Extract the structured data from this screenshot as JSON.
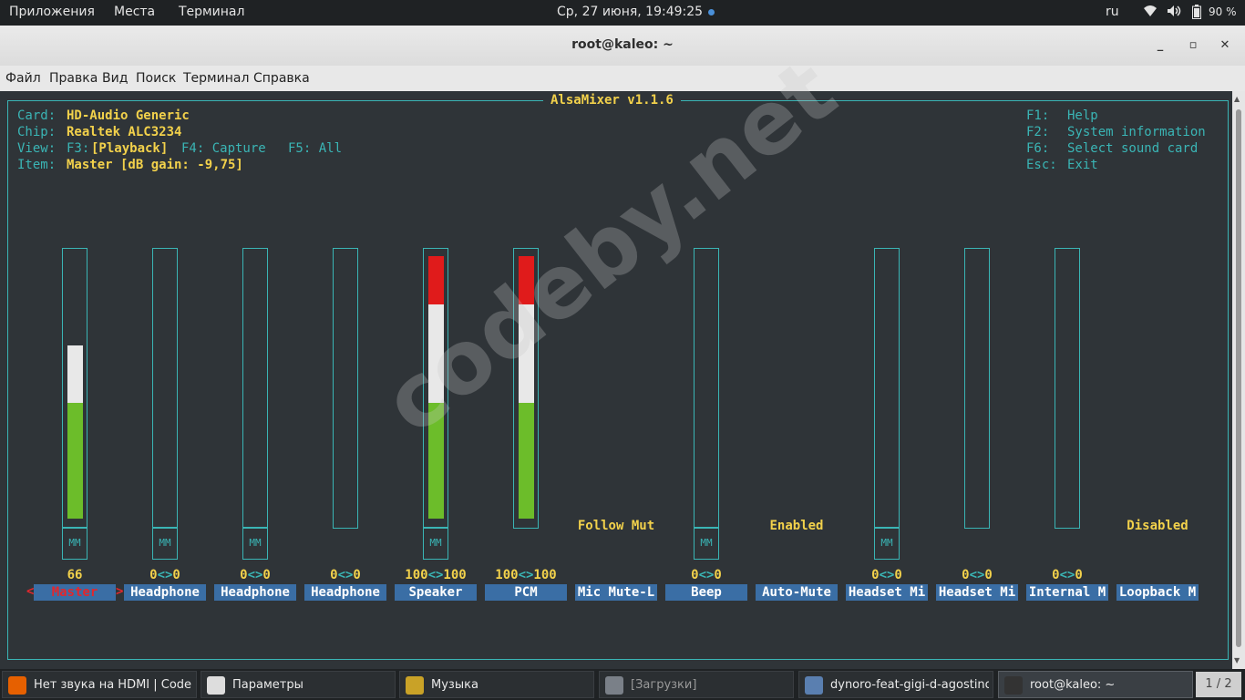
{
  "topbar": {
    "apps": "Приложения",
    "places": "Места",
    "terminal": "Терминал",
    "clock": "Ср, 27 июня, 19:49:25",
    "lang": "ru",
    "battery": "90 %"
  },
  "window": {
    "title": "root@kaleo: ~",
    "minimize": "_",
    "maximize": "▫",
    "close": "✕"
  },
  "menu": [
    "Файл",
    "Правка",
    "Вид",
    "Поиск",
    "Терминал",
    "Справка"
  ],
  "alsamixer": {
    "title": "AlsaMixer v1.1.6",
    "card_label": "Card:",
    "card_value": "HD-Audio Generic",
    "chip_label": "Chip:",
    "chip_value": "Realtek ALC3234",
    "view_label": "View:",
    "view_f3": "F3:",
    "view_playback": "[Playback]",
    "view_f4": "F4: Capture",
    "view_f5": "F5: All",
    "item_label": "Item:",
    "item_value": "Master [dB gain: -9,75]",
    "help": [
      {
        "key": "F1:",
        "text": "Help"
      },
      {
        "key": "F2:",
        "text": "System information"
      },
      {
        "key": "F6:",
        "text": "Select sound card"
      },
      {
        "key": "Esc:",
        "text": "Exit"
      }
    ],
    "controls": [
      {
        "name": "Master",
        "value": "66",
        "level": 0.66,
        "mm": "MM",
        "selected": true
      },
      {
        "name": "Headphone",
        "value": "0<>0",
        "level": 0,
        "mm": "MM"
      },
      {
        "name": "Headphone",
        "value": "0<>0",
        "level": 0,
        "mm": "MM"
      },
      {
        "name": "Headphone",
        "value": "0<>0",
        "level": 0,
        "mm": ""
      },
      {
        "name": "Speaker",
        "value": "100<>100",
        "level": 1.0,
        "mm": "MM"
      },
      {
        "name": "PCM",
        "value": "100<>100",
        "level": 1.0,
        "mm": ""
      },
      {
        "name": "Mic Mute-L",
        "value": "",
        "status": "Follow Mut"
      },
      {
        "name": "Beep",
        "value": "0<>0",
        "level": 0,
        "mm": "MM"
      },
      {
        "name": "Auto-Mute",
        "value": "",
        "status": "Enabled"
      },
      {
        "name": "Headset Mi",
        "value": "0<>0",
        "level": 0,
        "mm": "MM"
      },
      {
        "name": "Headset Mi",
        "value": "0<>0",
        "level": 0,
        "mm": ""
      },
      {
        "name": "Internal M",
        "value": "0<>0",
        "level": 0,
        "mm": ""
      },
      {
        "name": "Loopback M",
        "value": "",
        "status": "Disabled"
      }
    ],
    "sel_left": "<",
    "sel_right": ">"
  },
  "watermark": "codeby.net",
  "taskbar": [
    {
      "label": "Нет звука на HDMI | Codeby...",
      "icon": "firefox-icon",
      "color": "#e66000"
    },
    {
      "label": "Параметры",
      "icon": "settings-icon",
      "color": "#dddddd"
    },
    {
      "label": "Музыка",
      "icon": "music-icon",
      "color": "#c9a227"
    },
    {
      "label": "[Загрузки]",
      "icon": "folder-icon",
      "color": "#7a8088",
      "dim": true
    },
    {
      "label": "dynoro-feat-gigi-d-agostino_-...",
      "icon": "media-icon",
      "color": "#5a7fb0"
    },
    {
      "label": "root@kaleo: ~",
      "icon": "terminal-icon",
      "color": "#333333",
      "active": true
    }
  ],
  "pager": "1 / 2"
}
